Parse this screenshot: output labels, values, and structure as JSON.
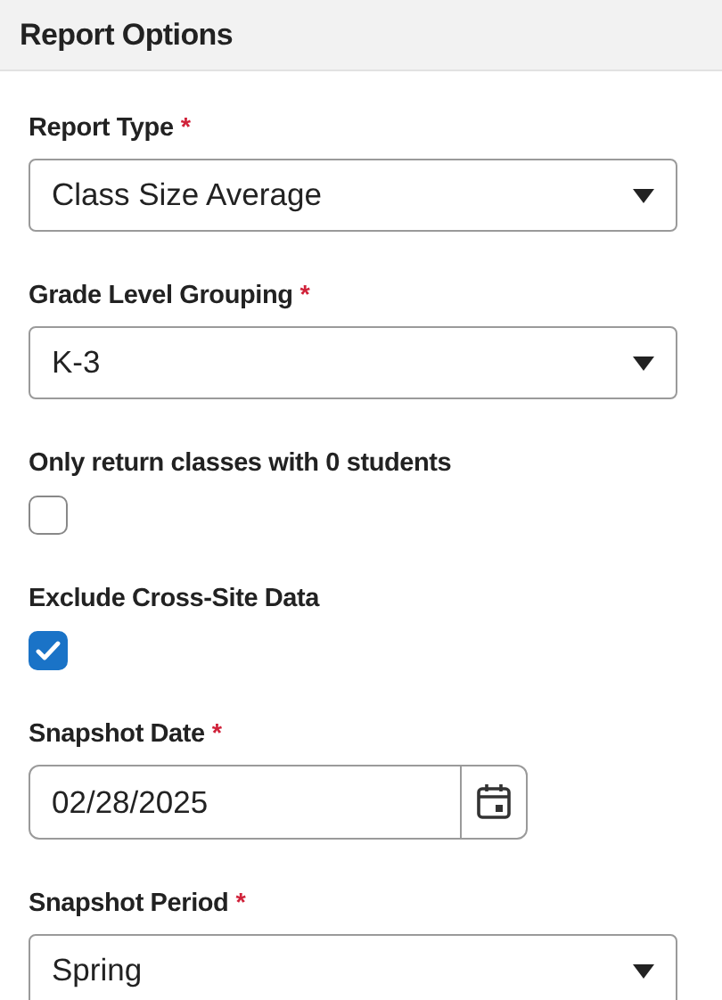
{
  "panel": {
    "title": "Report Options"
  },
  "fields": [
    {
      "kind": "select",
      "label": "Report Type",
      "required_mark": "*",
      "value": "Class Size Average"
    },
    {
      "kind": "select",
      "label": "Grade Level Grouping",
      "required_mark": "*",
      "value": "K-3"
    },
    {
      "kind": "checkbox",
      "label": "Only return classes with 0 students",
      "checked": false
    },
    {
      "kind": "checkbox",
      "label": "Exclude Cross-Site Data",
      "checked": true
    },
    {
      "kind": "date",
      "label": "Snapshot Date",
      "required_mark": "*",
      "value": "02/28/2025"
    },
    {
      "kind": "select",
      "label": "Snapshot Period",
      "required_mark": "*",
      "value": "Spring"
    }
  ]
}
